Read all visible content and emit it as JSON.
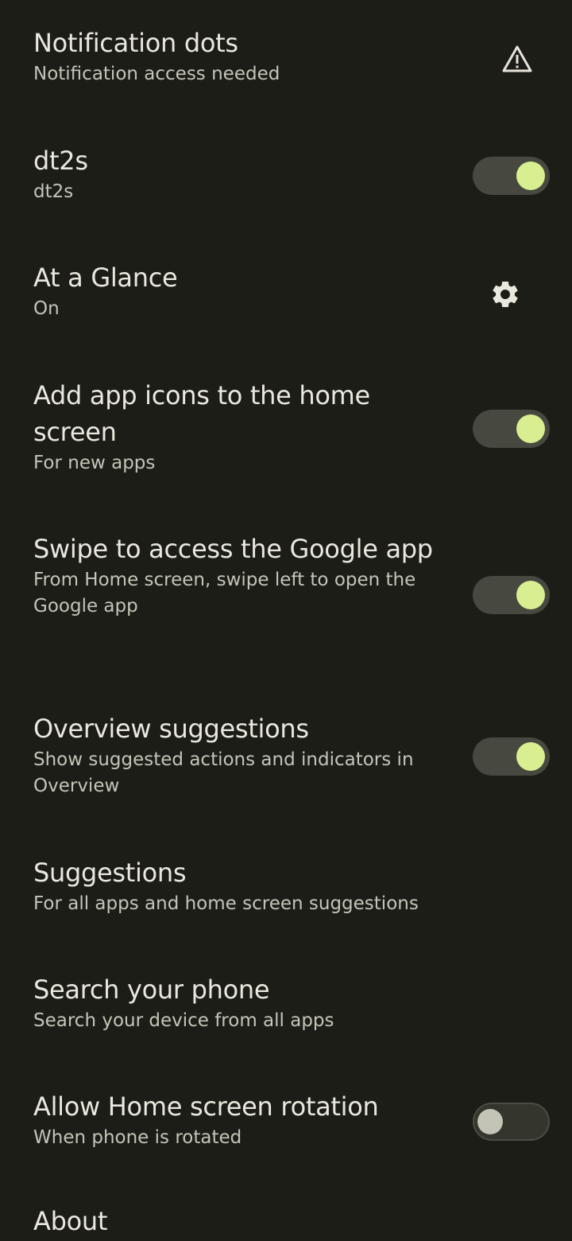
{
  "settings": {
    "notification_dots": {
      "title": "Notification dots",
      "summary": "Notification access needed",
      "icon": "warning-icon"
    },
    "dt2s": {
      "title": "dt2s",
      "summary": "dt2s",
      "enabled": true
    },
    "at_a_glance": {
      "title": "At a Glance",
      "summary": "On",
      "icon": "gear-icon"
    },
    "add_app_icons": {
      "title": "Add app icons to the home screen",
      "summary": "For new apps",
      "enabled": true
    },
    "swipe_google_app": {
      "title": "Swipe to access the Google app",
      "summary": "From Home screen, swipe left to open the Google app",
      "enabled": true
    },
    "overview_suggestions": {
      "title": "Overview suggestions",
      "summary": "Show suggested actions and indicators in Overview",
      "enabled": true
    },
    "suggestions": {
      "title": "Suggestions",
      "summary": "For all apps and home screen suggestions"
    },
    "search_phone": {
      "title": "Search your phone",
      "summary": "Search your device from all apps"
    },
    "home_rotation": {
      "title": "Allow Home screen rotation",
      "summary": "When phone is rotated",
      "enabled": false
    },
    "about": {
      "title": "About"
    }
  },
  "colors": {
    "background": "#1c1d17",
    "switch_on_thumb": "#d8ee91",
    "switch_track": "#474840"
  }
}
